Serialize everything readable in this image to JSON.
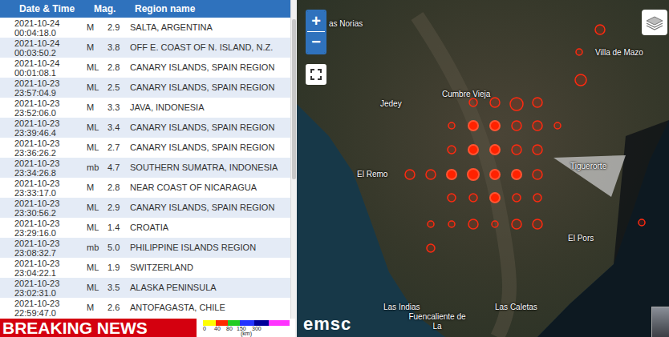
{
  "table": {
    "columns": [
      "Date & Time",
      "Mag.",
      "Region name"
    ],
    "rows": [
      {
        "date": "2021-10-24",
        "time": "00:04:18.0",
        "type": "M",
        "mag": "2.9",
        "region": "SALTA, ARGENTINA"
      },
      {
        "date": "2021-10-24",
        "time": "00:03:50.2",
        "type": "M",
        "mag": "3.8",
        "region": "OFF E. COAST OF N. ISLAND, N.Z."
      },
      {
        "date": "2021-10-24",
        "time": "00:01:08.1",
        "type": "ML",
        "mag": "2.8",
        "region": "CANARY ISLANDS, SPAIN REGION"
      },
      {
        "date": "2021-10-23",
        "time": "23:57:04.9",
        "type": "ML",
        "mag": "2.5",
        "region": "CANARY ISLANDS, SPAIN REGION"
      },
      {
        "date": "2021-10-23",
        "time": "23:52:06.0",
        "type": "M",
        "mag": "3.3",
        "region": "JAVA, INDONESIA"
      },
      {
        "date": "2021-10-23",
        "time": "23:39:46.4",
        "type": "ML",
        "mag": "3.4",
        "region": "CANARY ISLANDS, SPAIN REGION"
      },
      {
        "date": "2021-10-23",
        "time": "23:36:26.2",
        "type": "ML",
        "mag": "2.7",
        "region": "CANARY ISLANDS, SPAIN REGION"
      },
      {
        "date": "2021-10-23",
        "time": "23:34:26.8",
        "type": "mb",
        "mag": "4.7",
        "region": "SOUTHERN SUMATRA, INDONESIA"
      },
      {
        "date": "2021-10-23",
        "time": "23:33:17.0",
        "type": "M",
        "mag": "2.8",
        "region": "NEAR COAST OF NICARAGUA"
      },
      {
        "date": "2021-10-23",
        "time": "23:30:56.2",
        "type": "ML",
        "mag": "2.9",
        "region": "CANARY ISLANDS, SPAIN REGION"
      },
      {
        "date": "2021-10-23",
        "time": "23:29:16.0",
        "type": "ML",
        "mag": "1.4",
        "region": "CROATIA"
      },
      {
        "date": "2021-10-23",
        "time": "23:08:32.7",
        "type": "mb",
        "mag": "5.0",
        "region": "PHILIPPINE ISLANDS REGION"
      },
      {
        "date": "2021-10-23",
        "time": "23:04:22.1",
        "type": "ML",
        "mag": "1.9",
        "region": "SWITZERLAND"
      },
      {
        "date": "2021-10-23",
        "time": "23:02:31.0",
        "type": "ML",
        "mag": "3.5",
        "region": "ALASKA PENINSULA"
      },
      {
        "date": "2021-10-23",
        "time": "22:59:47.0",
        "type": "M",
        "mag": "2.6",
        "region": "ANTOFAGASTA, CHILE"
      }
    ]
  },
  "map": {
    "zoom_in": "+",
    "zoom_out": "−",
    "labels": [
      "as Norias",
      "Villa de Mazo",
      "Jedey",
      "Cumbre Vieja",
      "El Remo",
      "Tiguerorte",
      "El Pors",
      "Las Indias",
      "Las Caletas",
      "Fuencaliente de La"
    ],
    "markers": [
      {
        "kind": "ring"
      },
      {
        "kind": "ring"
      },
      {
        "kind": "ring"
      },
      {
        "kind": "ring"
      },
      {
        "kind": "ring"
      },
      {
        "kind": "solid"
      },
      {
        "kind": "solid"
      },
      {
        "kind": "ring"
      },
      {
        "kind": "ring"
      },
      {
        "kind": "ring"
      },
      {
        "kind": "ring"
      },
      {
        "kind": "solid"
      },
      {
        "kind": "solid"
      },
      {
        "kind": "ring"
      },
      {
        "kind": "ring"
      },
      {
        "kind": "ring"
      },
      {
        "kind": "ring"
      },
      {
        "kind": "solid"
      },
      {
        "kind": "solid"
      },
      {
        "kind": "solid"
      },
      {
        "kind": "solid"
      },
      {
        "kind": "ring"
      },
      {
        "kind": "ring"
      },
      {
        "kind": "ring"
      },
      {
        "kind": "solid"
      },
      {
        "kind": "ring"
      },
      {
        "kind": "ring"
      },
      {
        "kind": "ring"
      },
      {
        "kind": "ring"
      },
      {
        "kind": "ring"
      },
      {
        "kind": "ring"
      },
      {
        "kind": "ring"
      },
      {
        "kind": "ring"
      },
      {
        "kind": "ring"
      },
      {
        "kind": "ring"
      },
      {
        "kind": "ring"
      },
      {
        "kind": "ring"
      },
      {
        "kind": "ring"
      }
    ],
    "logo": "emsc"
  },
  "banner": "BREAKING NEWS",
  "legend": {
    "segments": [
      {
        "color": "#ffff00"
      },
      {
        "color": "#ff2a00"
      },
      {
        "color": "#22cc22"
      },
      {
        "color": "#2233ff"
      },
      {
        "color": "#000099"
      },
      {
        "color": "#ff33ff"
      }
    ],
    "ticks": [
      "0",
      "40",
      "80",
      "150",
      "300"
    ],
    "unit": "(km)"
  }
}
